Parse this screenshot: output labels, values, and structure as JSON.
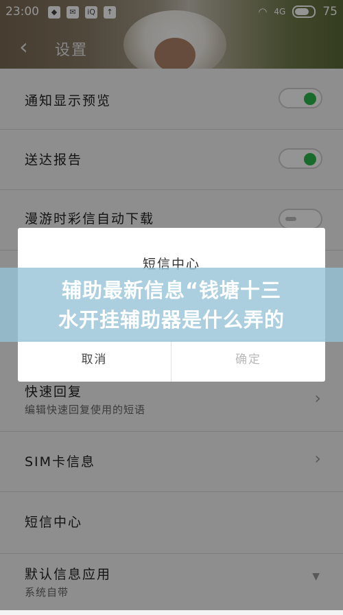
{
  "status_bar": {
    "time": "23:00",
    "icons": [
      "baidu-icon",
      "mail-icon",
      "iqiyi-icon",
      "upload-icon"
    ],
    "wifi_label": "WiFi",
    "signal_label": "4G",
    "battery": "75"
  },
  "header": {
    "title": "设置"
  },
  "settings": [
    {
      "label": "通知显示预览",
      "control": "toggle",
      "state": "on"
    },
    {
      "label": "送达报告",
      "control": "toggle",
      "state": "on"
    },
    {
      "label": "漫游时彩信自动下载",
      "control": "toggle",
      "state": "off"
    },
    {
      "label": "快速回复",
      "sublabel": "编辑快速回复使用的短语",
      "control": "chevron"
    },
    {
      "label": "SIM卡信息",
      "control": "chevron"
    },
    {
      "label": "短信中心",
      "control": "none"
    },
    {
      "label": "默认信息应用",
      "sublabel": "系统自带",
      "control": "dropdown"
    }
  ],
  "dialog": {
    "title": "短信中心",
    "cancel": "取消",
    "confirm": "确定"
  },
  "banner": {
    "line1": "辅助最新信息“钱塘十三",
    "line2": "水开挂辅助器是什么弄的"
  },
  "colors": {
    "toggle_on": "#2eb84a",
    "banner": "#96c3d7"
  }
}
